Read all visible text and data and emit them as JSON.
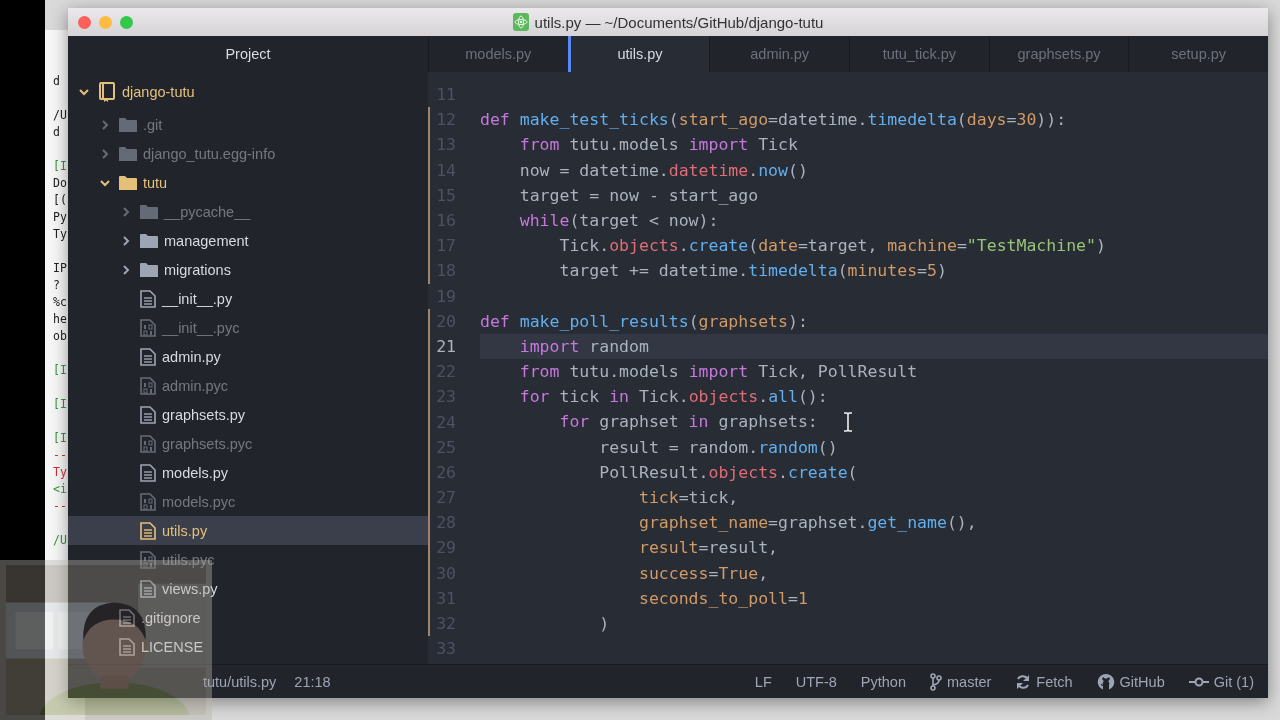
{
  "window": {
    "title": "utils.py — ~/Documents/GitHub/django-tutu"
  },
  "terminal": {
    "blocks": [
      {
        "lines": [
          {
            "text": "d",
            "kind": "plain"
          }
        ]
      },
      {
        "lines": [
          {
            "text": "/U",
            "kind": "plain"
          },
          {
            "text": "d",
            "kind": "plain"
          }
        ]
      },
      {
        "lines": [
          {
            "text": "[I",
            "kind": "prompt"
          },
          {
            "text": "Do",
            "kind": "plain"
          },
          {
            "text": "[(",
            "kind": "plain"
          },
          {
            "text": "Py",
            "kind": "plain"
          },
          {
            "text": "Ty",
            "kind": "plain"
          }
        ]
      },
      {
        "lines": [
          {
            "text": "IP",
            "kind": "plain"
          },
          {
            "text": "?",
            "kind": "plain"
          },
          {
            "text": "%c",
            "kind": "plain"
          },
          {
            "text": "he",
            "kind": "plain"
          },
          {
            "text": "ob",
            "kind": "plain"
          }
        ]
      },
      {
        "lines": [
          {
            "text": "[I",
            "kind": "prompt"
          }
        ]
      },
      {
        "lines": [
          {
            "text": "[I",
            "kind": "prompt"
          }
        ]
      },
      {
        "lines": [
          {
            "text": "[I",
            "kind": "prompt"
          },
          {
            "text": "--",
            "kind": "error"
          },
          {
            "text": "Ty",
            "kind": "error"
          },
          {
            "text": "<i",
            "kind": "prompt"
          },
          {
            "text": "--",
            "kind": "error"
          }
        ]
      },
      {
        "lines": [
          {
            "text": "/U",
            "kind": "prompt"
          }
        ]
      }
    ]
  },
  "sidebar": {
    "title": "Project",
    "tree": {
      "name": "django-tutu",
      "kind": "repo",
      "expanded": true,
      "modified": true,
      "ignored": false,
      "selected": false,
      "children": [
        {
          "name": ".git",
          "kind": "folder",
          "expanded": false,
          "modified": false,
          "ignored": true,
          "selected": false
        },
        {
          "name": "django_tutu.egg-info",
          "kind": "folder",
          "expanded": false,
          "modified": false,
          "ignored": true,
          "selected": false
        },
        {
          "name": "tutu",
          "kind": "folder",
          "expanded": true,
          "modified": true,
          "ignored": false,
          "selected": false,
          "children": [
            {
              "name": "__pycache__",
              "kind": "folder",
              "expanded": false,
              "modified": false,
              "ignored": true,
              "selected": false
            },
            {
              "name": "management",
              "kind": "folder",
              "expanded": false,
              "modified": false,
              "ignored": false,
              "selected": false
            },
            {
              "name": "migrations",
              "kind": "folder",
              "expanded": false,
              "modified": false,
              "ignored": false,
              "selected": false
            },
            {
              "name": "__init__.py",
              "kind": "file",
              "modified": false,
              "ignored": false,
              "selected": false
            },
            {
              "name": "__init__.pyc",
              "kind": "binary",
              "modified": false,
              "ignored": true,
              "selected": false
            },
            {
              "name": "admin.py",
              "kind": "file",
              "modified": false,
              "ignored": false,
              "selected": false
            },
            {
              "name": "admin.pyc",
              "kind": "binary",
              "modified": false,
              "ignored": true,
              "selected": false
            },
            {
              "name": "graphsets.py",
              "kind": "file",
              "modified": false,
              "ignored": false,
              "selected": false
            },
            {
              "name": "graphsets.pyc",
              "kind": "binary",
              "modified": false,
              "ignored": true,
              "selected": false
            },
            {
              "name": "models.py",
              "kind": "file",
              "modified": false,
              "ignored": false,
              "selected": false
            },
            {
              "name": "models.pyc",
              "kind": "binary",
              "modified": false,
              "ignored": true,
              "selected": false
            },
            {
              "name": "utils.py",
              "kind": "file",
              "modified": true,
              "ignored": false,
              "selected": true
            },
            {
              "name": "utils.pyc",
              "kind": "binary",
              "modified": false,
              "ignored": true,
              "selected": false
            },
            {
              "name": "views.py",
              "kind": "file",
              "modified": false,
              "ignored": false,
              "selected": false
            }
          ]
        },
        {
          "name": ".gitignore",
          "kind": "file",
          "modified": false,
          "ignored": false,
          "selected": false
        },
        {
          "name": "LICENSE",
          "kind": "file",
          "modified": false,
          "ignored": false,
          "selected": false
        }
      ]
    }
  },
  "tabs": [
    {
      "label": "models.py",
      "selected": false
    },
    {
      "label": "utils.py",
      "selected": true
    },
    {
      "label": "admin.py",
      "selected": false
    },
    {
      "label": "tutu_tick.py",
      "selected": false
    },
    {
      "label": "graphsets.py",
      "selected": false
    },
    {
      "label": "setup.py",
      "selected": false
    }
  ],
  "editor": {
    "lines": [
      {
        "number": "11",
        "current": false,
        "changed": false
      },
      {
        "number": "12",
        "current": false,
        "changed": true,
        "tokens": [
          {
            "t": "def",
            "kind": "keyword"
          },
          {
            "t": " make_test_ticks",
            "kind": "function"
          },
          {
            "t": "(",
            "kind": "plain"
          },
          {
            "t": "start_ago",
            "kind": "param"
          },
          {
            "t": "=datetime.",
            "kind": "plain"
          },
          {
            "t": "timedelta",
            "kind": "function"
          },
          {
            "t": "(",
            "kind": "plain"
          },
          {
            "t": "days",
            "kind": "param"
          },
          {
            "t": "=",
            "kind": "plain"
          },
          {
            "t": "30",
            "kind": "number"
          },
          {
            "t": ")):",
            "kind": "plain"
          }
        ]
      },
      {
        "number": "13",
        "current": false,
        "changed": true,
        "tokens": [
          {
            "t": "    from",
            "kind": "keyword"
          },
          {
            "t": " tutu.models",
            "kind": "plain"
          },
          {
            "t": " import",
            "kind": "keyword"
          },
          {
            "t": " Tick",
            "kind": "plain"
          }
        ]
      },
      {
        "number": "14",
        "current": false,
        "changed": true,
        "tokens": [
          {
            "t": "    now = datetime.",
            "kind": "plain"
          },
          {
            "t": "datetime",
            "kind": "property"
          },
          {
            "t": ".",
            "kind": "plain"
          },
          {
            "t": "now",
            "kind": "function"
          },
          {
            "t": "()",
            "kind": "plain"
          }
        ]
      },
      {
        "number": "15",
        "current": false,
        "changed": true,
        "tokens": [
          {
            "t": "    target = now - start_ago",
            "kind": "plain"
          }
        ]
      },
      {
        "number": "16",
        "current": false,
        "changed": true,
        "tokens": [
          {
            "t": "    while",
            "kind": "keyword"
          },
          {
            "t": "(target < now):",
            "kind": "plain"
          }
        ]
      },
      {
        "number": "17",
        "current": false,
        "changed": true,
        "tokens": [
          {
            "t": "        Tick.",
            "kind": "plain"
          },
          {
            "t": "objects",
            "kind": "property"
          },
          {
            "t": ".",
            "kind": "plain"
          },
          {
            "t": "create",
            "kind": "function"
          },
          {
            "t": "(",
            "kind": "plain"
          },
          {
            "t": "date",
            "kind": "param"
          },
          {
            "t": "=target,",
            "kind": "plain"
          },
          {
            "t": " machine",
            "kind": "param"
          },
          {
            "t": "=",
            "kind": "plain"
          },
          {
            "t": "\"TestMachine\"",
            "kind": "string"
          },
          {
            "t": ")",
            "kind": "plain"
          }
        ]
      },
      {
        "number": "18",
        "current": false,
        "changed": true,
        "tokens": [
          {
            "t": "        target += datetime.",
            "kind": "plain"
          },
          {
            "t": "timedelta",
            "kind": "function"
          },
          {
            "t": "(",
            "kind": "plain"
          },
          {
            "t": "minutes",
            "kind": "param"
          },
          {
            "t": "=",
            "kind": "plain"
          },
          {
            "t": "5",
            "kind": "number"
          },
          {
            "t": ")",
            "kind": "plain"
          }
        ]
      },
      {
        "number": "19",
        "current": false,
        "changed": false
      },
      {
        "number": "20",
        "current": false,
        "changed": true,
        "tokens": [
          {
            "t": "def",
            "kind": "keyword"
          },
          {
            "t": " make_poll_results",
            "kind": "function"
          },
          {
            "t": "(",
            "kind": "plain"
          },
          {
            "t": "graphsets",
            "kind": "param"
          },
          {
            "t": "):",
            "kind": "plain"
          }
        ]
      },
      {
        "number": "21",
        "current": true,
        "changed": true,
        "tokens": [
          {
            "t": "    import",
            "kind": "keyword"
          },
          {
            "t": " random",
            "kind": "plain"
          }
        ]
      },
      {
        "number": "22",
        "current": false,
        "changed": true,
        "tokens": [
          {
            "t": "    from",
            "kind": "keyword"
          },
          {
            "t": " tutu.models",
            "kind": "plain"
          },
          {
            "t": " import",
            "kind": "keyword"
          },
          {
            "t": " Tick, PollResult",
            "kind": "plain"
          }
        ]
      },
      {
        "number": "23",
        "current": false,
        "changed": true,
        "tokens": [
          {
            "t": "    for",
            "kind": "keyword"
          },
          {
            "t": " tick",
            "kind": "plain"
          },
          {
            "t": " in",
            "kind": "keyword"
          },
          {
            "t": " Tick.",
            "kind": "plain"
          },
          {
            "t": "objects",
            "kind": "property"
          },
          {
            "t": ".",
            "kind": "plain"
          },
          {
            "t": "all",
            "kind": "function"
          },
          {
            "t": "():",
            "kind": "plain"
          }
        ]
      },
      {
        "number": "24",
        "current": false,
        "changed": true,
        "tokens": [
          {
            "t": "        for",
            "kind": "keyword"
          },
          {
            "t": " graphset",
            "kind": "plain"
          },
          {
            "t": " in",
            "kind": "keyword"
          },
          {
            "t": " graphsets:",
            "kind": "plain"
          }
        ]
      },
      {
        "number": "25",
        "current": false,
        "changed": true,
        "tokens": [
          {
            "t": "            result = random.",
            "kind": "plain"
          },
          {
            "t": "random",
            "kind": "function"
          },
          {
            "t": "()",
            "kind": "plain"
          }
        ]
      },
      {
        "number": "26",
        "current": false,
        "changed": true,
        "tokens": [
          {
            "t": "            PollResult.",
            "kind": "plain"
          },
          {
            "t": "objects",
            "kind": "property"
          },
          {
            "t": ".",
            "kind": "plain"
          },
          {
            "t": "create",
            "kind": "function"
          },
          {
            "t": "(",
            "kind": "plain"
          }
        ]
      },
      {
        "number": "27",
        "current": false,
        "changed": true,
        "tokens": [
          {
            "t": "                tick",
            "kind": "param"
          },
          {
            "t": "=tick,",
            "kind": "plain"
          }
        ]
      },
      {
        "number": "28",
        "current": false,
        "changed": true,
        "tokens": [
          {
            "t": "                graphset_name",
            "kind": "param"
          },
          {
            "t": "=graphset.",
            "kind": "plain"
          },
          {
            "t": "get_name",
            "kind": "function"
          },
          {
            "t": "(),",
            "kind": "plain"
          }
        ]
      },
      {
        "number": "29",
        "current": false,
        "changed": true,
        "tokens": [
          {
            "t": "                result",
            "kind": "param"
          },
          {
            "t": "=result,",
            "kind": "plain"
          }
        ]
      },
      {
        "number": "30",
        "current": false,
        "changed": true,
        "tokens": [
          {
            "t": "                success",
            "kind": "param"
          },
          {
            "t": "=",
            "kind": "plain"
          },
          {
            "t": "True",
            "kind": "number"
          },
          {
            "t": ",",
            "kind": "plain"
          }
        ]
      },
      {
        "number": "31",
        "current": false,
        "changed": true,
        "tokens": [
          {
            "t": "                seconds_to_poll",
            "kind": "param"
          },
          {
            "t": "=",
            "kind": "plain"
          },
          {
            "t": "1",
            "kind": "number"
          }
        ]
      },
      {
        "number": "32",
        "current": false,
        "changed": true,
        "tokens": [
          {
            "t": "            )",
            "kind": "plain"
          }
        ]
      },
      {
        "number": "33",
        "current": false,
        "changed": false
      }
    ]
  },
  "status_bar": {
    "path": "tutu/utils.py",
    "cursor": "21:18",
    "items": [
      {
        "label": "LF",
        "kind": "text"
      },
      {
        "label": "UTF-8",
        "kind": "text"
      },
      {
        "label": "Python",
        "kind": "text"
      },
      {
        "label": "master",
        "kind": "branch"
      },
      {
        "label": "Fetch",
        "kind": "sync"
      },
      {
        "label": "GitHub",
        "kind": "cat"
      },
      {
        "label": "Git (1)",
        "kind": "commit"
      }
    ]
  }
}
